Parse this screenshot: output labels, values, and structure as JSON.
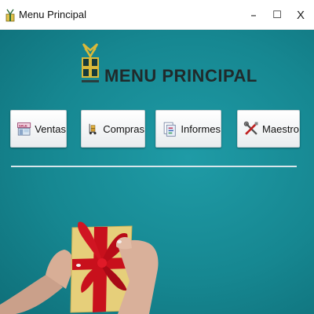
{
  "window": {
    "title": "Menu Principal",
    "controls": {
      "minimize": "–",
      "maximize": "☐",
      "close": "X"
    }
  },
  "header": {
    "title": "MENU PRINCIPAL",
    "logo_icon": "gift-logo-icon"
  },
  "buttons": [
    {
      "label": "Ventas",
      "icon": "store-sale-icon"
    },
    {
      "label": "Compras",
      "icon": "hand-truck-icon"
    },
    {
      "label": "Informes",
      "icon": "reports-icon"
    },
    {
      "label": "Maestro",
      "icon": "tools-icon"
    }
  ],
  "colors": {
    "background": "#168791",
    "ribbon": "#c8101c",
    "gift_box": "#e8d27a"
  }
}
